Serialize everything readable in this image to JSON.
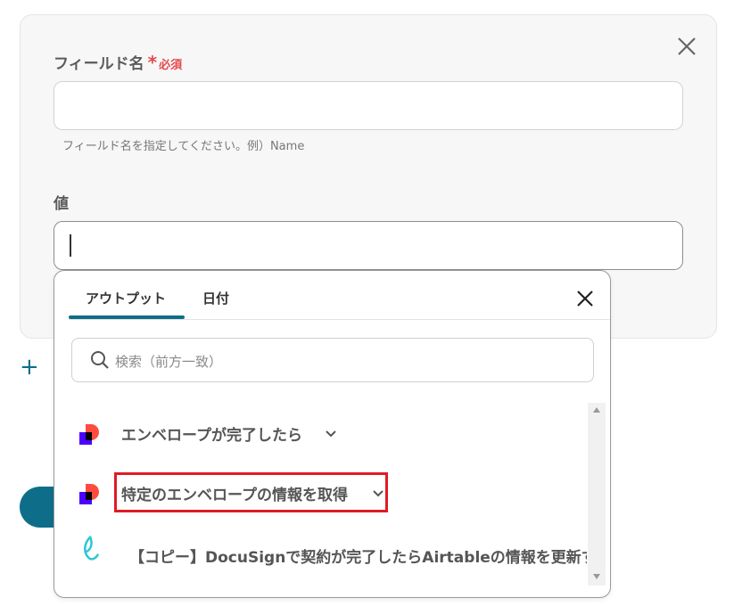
{
  "form": {
    "field_name_label": "フィールド名",
    "required_star": "*",
    "required_text": "必須",
    "field_name_value": "",
    "field_name_hint": "フィールド名を指定してください。例）Name",
    "value_label": "値",
    "value_value": ""
  },
  "popup": {
    "tabs": [
      {
        "label": "アウトプット",
        "active": true
      },
      {
        "label": "日付",
        "active": false
      }
    ],
    "search_placeholder": "検索（前方一致）",
    "items": [
      {
        "label": "エンベロープが完了したら",
        "icon": "docusign-icon",
        "expandable": true
      },
      {
        "label": "特定のエンベロープの情報を取得",
        "icon": "docusign-icon",
        "expandable": true,
        "highlighted": true
      },
      {
        "label": "【コピー】DocuSignで契約が完了したらAirtableの情報を更新する",
        "icon": "yoom-icon",
        "expandable": false
      }
    ]
  },
  "colors": {
    "accent": "#0e6e8a",
    "required": "#e5484d",
    "highlight_box": "#e01b24",
    "docusign_red": "#ff4b3e",
    "docusign_purple": "#4c00ff",
    "yoom_teal": "#2bc6d6"
  }
}
